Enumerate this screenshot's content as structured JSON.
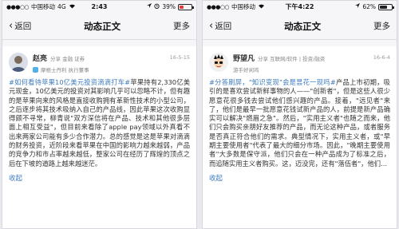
{
  "left": {
    "status": {
      "carrier": "中国移动",
      "network": "4G",
      "time": "2:43",
      "battery_text": "39%",
      "battery_level": 0.39
    },
    "nav": {
      "back_label": "返回",
      "title": "动态正文",
      "more_label": "更多"
    },
    "post": {
      "author_name": "赵亮",
      "author_meta": "分享 金融 证券",
      "author_desc": "摩根士丹利 执行董事",
      "date": "16-5-15",
      "hashtag": "#如何看待苹果10亿美元投资滴滴打车#",
      "body": "苹果持有2,330亿美元现金，10亿美元的投资对其影响几乎可以忽略不计，但有趣的是苹果向来的风格是直接收购拥有革新性技术的小型公司，之后逐步将其技术吸纳入自己的产品线，因此苹果这次收购显得颇不寻常，柳青说\"双方深信将在产品、技术和其他很多层面上相互受益\"，但目前来看除了apple pay领域以外真看不出来两家公司能有多少合作潜力。总的感觉是这是苹果对滴滴的财务投资，近阶段来看苹果在中国的影响力越来越弱，产品的竞争力和市占率越来越低，整家公司在经历了辉煌的顶点之后在下坡的道路上越来越迷茫。",
      "collapse_label": "收起"
    }
  },
  "right": {
    "status": {
      "carrier": "中国移动",
      "network": "",
      "time": "下午4:22",
      "battery_text": "62%",
      "battery_level": 0.62
    },
    "nav": {
      "back_label": "返回",
      "title": "动态正文",
      "more_label": "更多"
    },
    "post": {
      "author_name": "野望凡",
      "author_meta": "分享 互联网/软件 | 投资/融资",
      "author_desc": "游手好闲鸡",
      "date": "16-6-4",
      "hashtag": "#分答刷屏，\"知识变现\"会是昙花一现吗#",
      "body": "产品上市初期，吸引的是喜欢尝试新鲜事物的人——\"创新者\"，但是这些人很少愿意花很多钱去尝试他们感兴趣的产品。接着，\"远见者\"来了，他们是最早一批愿意花钱试新产品的人，前提是新产品确实可以解决\"燃眉之急\"。然后，\"实用主义者\"也随之而来，他们只会购买亲朋好友推荐的产品，而无论这种产品，或者服务是否真正符合他们的需求。典型情况下，实用主义者，或\"早期主要使用者\"代表了最大的细分市场。因此，\"晚期主要使用者\"大多数是保守派，他们只会在一种产品成为了标准之后，而追随实用主义者购买。这，迈没完，还有\"落伍者\"，他们...",
      "collapse_label": "收起"
    }
  }
}
